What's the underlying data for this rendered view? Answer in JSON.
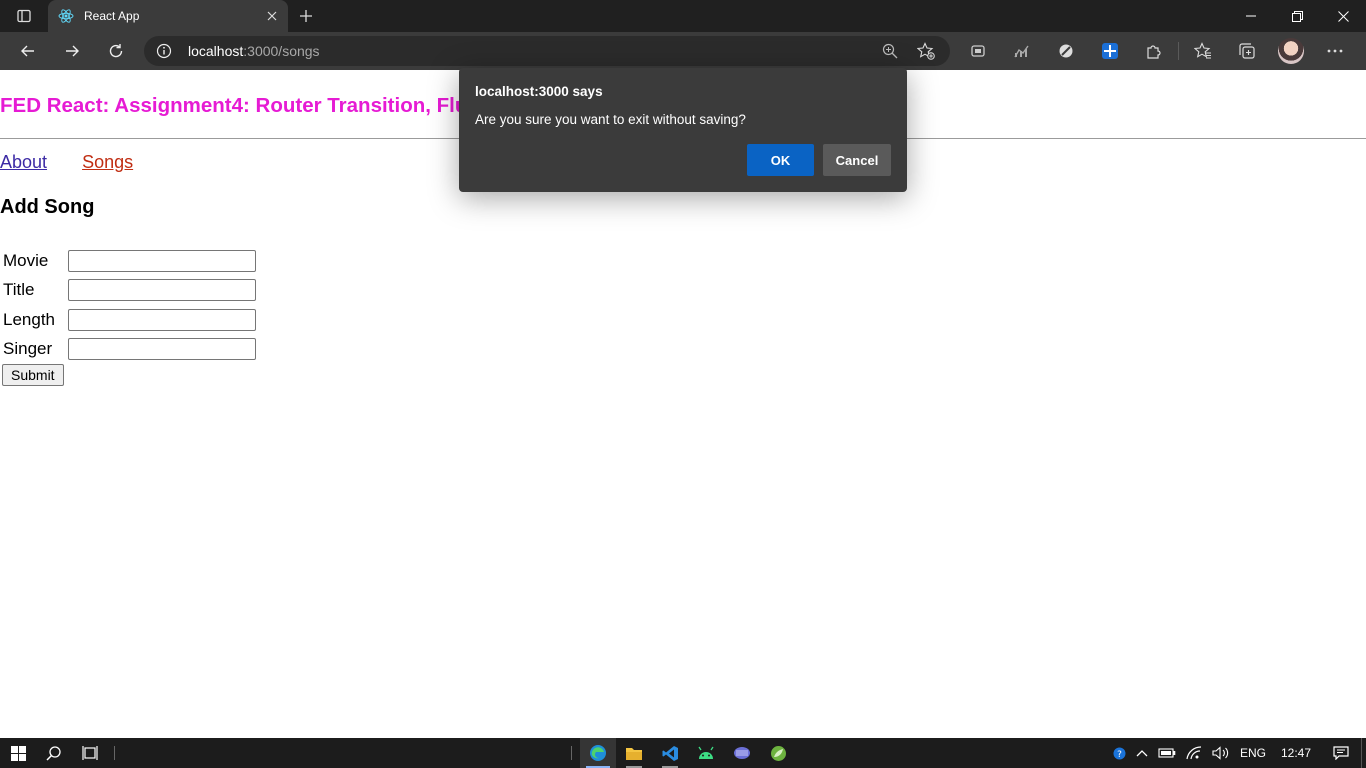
{
  "browser": {
    "tab": {
      "title": "React App",
      "favicon": "react-icon"
    },
    "address": {
      "host": "localhost",
      "path": ":3000/songs"
    },
    "icons": [
      "sidebar-toggle-icon",
      "close-icon",
      "plus-icon",
      "back-icon",
      "forward-icon",
      "refresh-icon",
      "info-icon",
      "zoom-icon",
      "add-favorite-icon",
      "extension-icons",
      "favorites-icon",
      "collections-icon",
      "profile-avatar",
      "more-icon"
    ]
  },
  "page": {
    "app_title": "FED React: Assignment4: Router Transition, Flux",
    "nav": {
      "about": "About",
      "songs": "Songs"
    },
    "section_title": "Add Song",
    "form": {
      "fields": [
        {
          "label": "Movie",
          "value": ""
        },
        {
          "label": "Title",
          "value": ""
        },
        {
          "label": "Length",
          "value": ""
        },
        {
          "label": "Singer",
          "value": ""
        }
      ],
      "submit_label": "Submit"
    }
  },
  "dialog": {
    "title": "localhost:3000 says",
    "message": "Are you sure you want to exit without saving?",
    "ok_label": "OK",
    "cancel_label": "Cancel"
  },
  "taskbar": {
    "language": "ENG",
    "time": "12:47"
  },
  "colors": {
    "title": "#e61bd4",
    "link_visited": "#3c2aa5",
    "link_active": "#c02d12",
    "dialog_bg": "#3b3b3b",
    "ok_button": "#0a63c4",
    "cancel_button": "#5a5a5a"
  }
}
